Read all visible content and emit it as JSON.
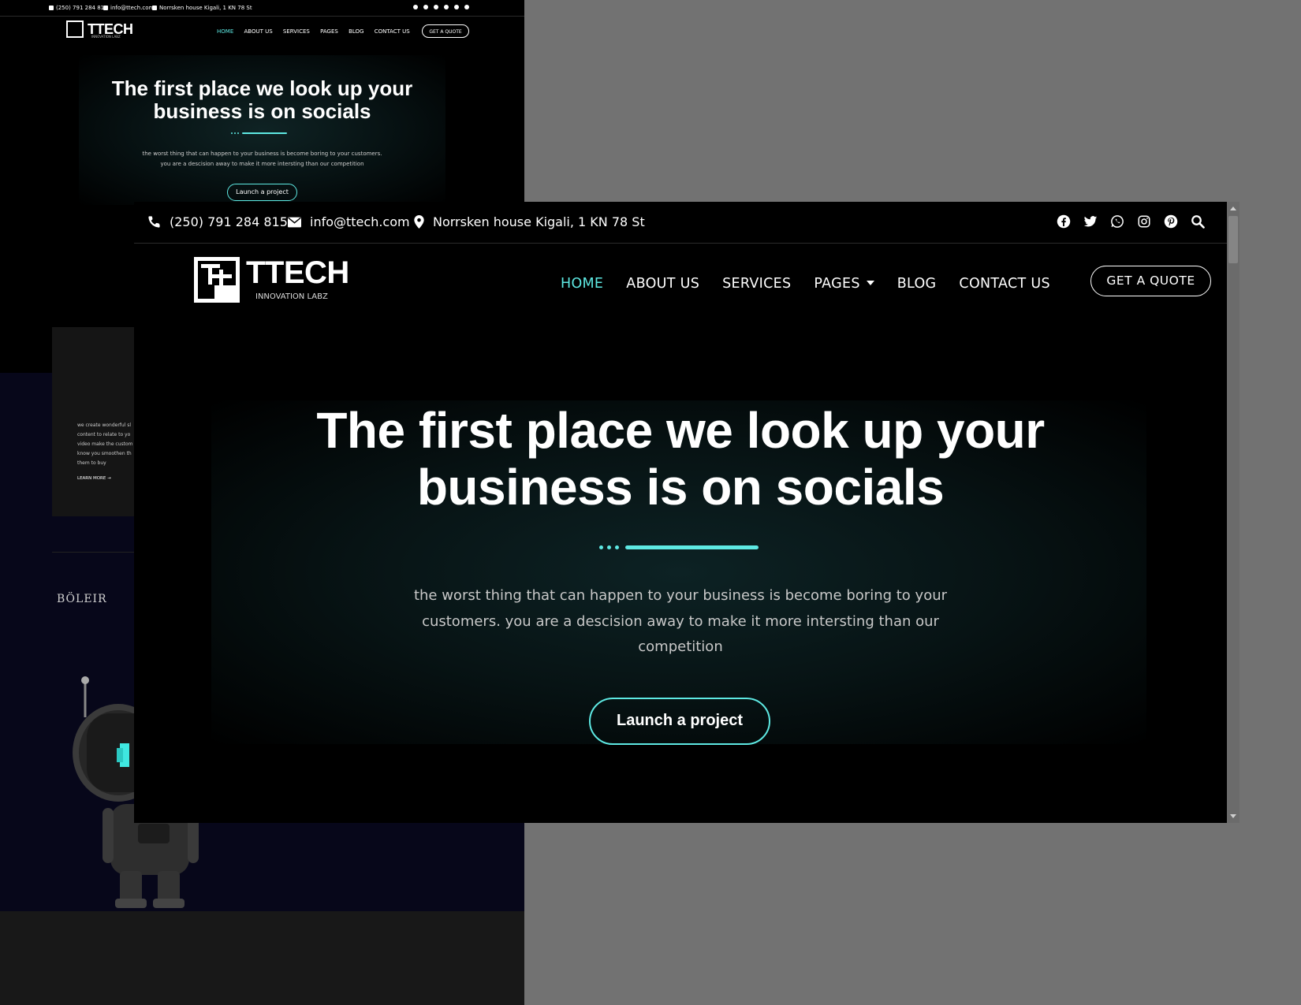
{
  "background_page": {
    "topbar": {
      "phone": "(250) 791 284 815",
      "email": "info@ttech.com",
      "address": "Norrsken house Kigali, 1 KN 78 St"
    },
    "logo": {
      "name": "TTECH",
      "tagline": "INNOVATION LABZ"
    },
    "nav": {
      "items": [
        "HOME",
        "ABOUT US",
        "SERVICES",
        "PAGES",
        "BLOG",
        "CONTACT US"
      ],
      "active": "HOME",
      "quote_label": "GET A QUOTE"
    },
    "hero": {
      "headline_line1": "The first place we look up your",
      "headline_line2": "business is on socials",
      "subtext": "the worst thing that can happen to your business is become boring to your customers. you are a descision away to make it more intersting than our competition",
      "cta": "Launch a project"
    },
    "card": {
      "lines": [
        "we create wonderful sl",
        "content to relate to yo",
        "video make the custom",
        "know you smoothen th",
        "them to buy"
      ],
      "link": "LEARN MORE →"
    },
    "brand_logo": "BÖLEIR"
  },
  "foreground_page": {
    "topbar": {
      "phone": "(250) 791 284 815",
      "email": "info@ttech.com",
      "address": "Norrsken house Kigali, 1 KN 78 St",
      "social_icons": [
        "facebook-icon",
        "twitter-icon",
        "whatsapp-icon",
        "instagram-icon",
        "pinterest-icon",
        "search-icon"
      ]
    },
    "logo": {
      "name": "TTECH",
      "tagline": "INNOVATION LABZ"
    },
    "nav": {
      "home": "HOME",
      "about": "ABOUT US",
      "services": "SERVICES",
      "pages": "PAGES",
      "blog": "BLOG",
      "contact": "CONTACT US",
      "quote_label": "GET A QUOTE"
    },
    "hero": {
      "headline_line1": "The first place we look up your",
      "headline_line2": "business is on socials",
      "subtext": "the worst thing that can happen to your business is become boring to your customers. you are a descision away to make it more intersting than our competition",
      "cta": "Launch a project"
    }
  },
  "colors": {
    "accent": "#5ee9e3",
    "page_background": "#000000",
    "desktop_background": "#727272",
    "lower_section": "#07071a"
  }
}
